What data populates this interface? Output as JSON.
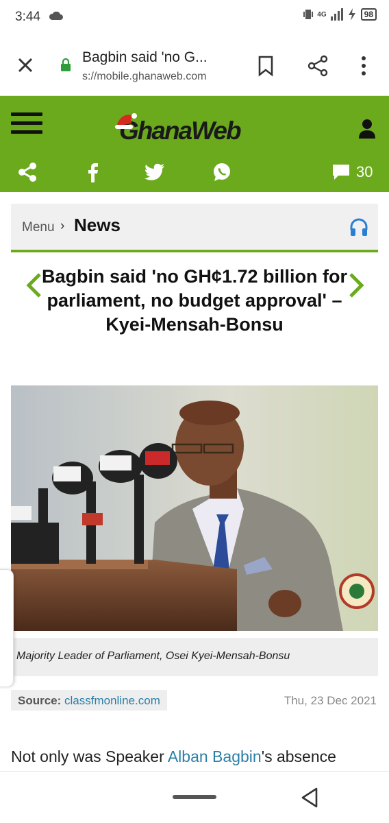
{
  "status_bar": {
    "time": "3:44",
    "network": "4G",
    "battery": "98"
  },
  "browser": {
    "page_title": "Bagbin said 'no G...",
    "url": "s://mobile.ghanaweb.com",
    "icons": [
      "close-icon",
      "lock-icon",
      "bookmark-icon",
      "share-icon",
      "more-icon"
    ]
  },
  "site_header": {
    "logo_text": "GhanaWeb",
    "comment_count": "30",
    "social_icons": [
      "share-icon",
      "facebook-icon",
      "twitter-icon",
      "whatsapp-icon",
      "comment-icon"
    ],
    "brand_color": "#6aaa1c"
  },
  "breadcrumb": {
    "menu_label": "Menu",
    "separator": "›",
    "section": "News"
  },
  "article": {
    "headline": "Bagbin said 'no GH¢1.72 billion for parliament, no budget approval' – Kyei-Mensah-Bonsu",
    "caption": "Majority Leader of Parliament, Osei Kyei-Mensah-Bonsu",
    "source_label": "Source:",
    "source_name": "classfmonline.com",
    "date": "Thu, 23 Dec 2021",
    "body_start": "Not only was Speaker ",
    "body_link": "Alban Bagbin",
    "body_end": "'s absence"
  }
}
